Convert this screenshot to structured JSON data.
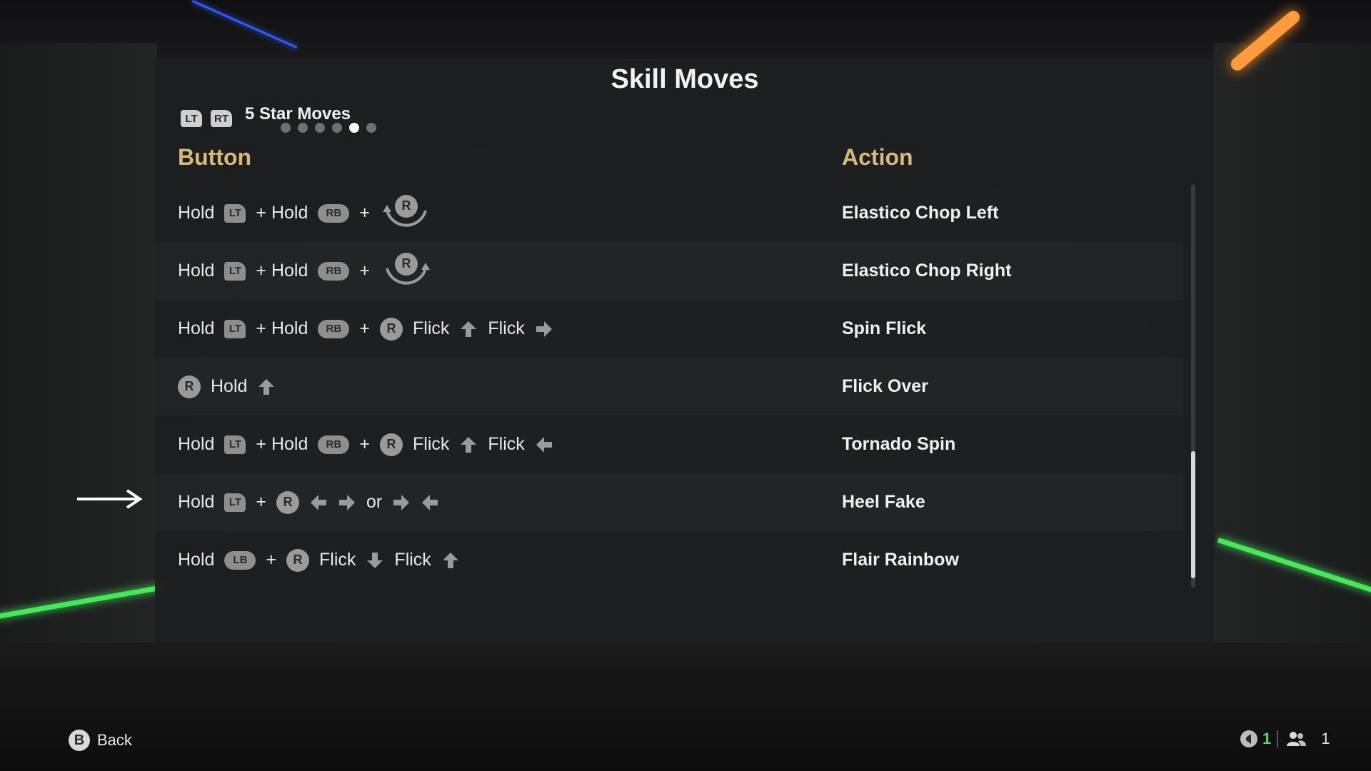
{
  "title": "Skill Moves",
  "category": {
    "triggers": [
      "LT",
      "RT"
    ],
    "label": "5 Star Moves",
    "page_count": 6,
    "active_page": 5
  },
  "columns": {
    "button": "Button",
    "action": "Action"
  },
  "moves": [
    {
      "tokens": [
        "Hold",
        "LT",
        "+ Hold",
        "RB",
        "+",
        "R-rotate-left"
      ],
      "action": "Elastico Chop Left"
    },
    {
      "tokens": [
        "Hold",
        "LT",
        "+ Hold",
        "RB",
        "+",
        "R-rotate-right"
      ],
      "action": "Elastico Chop Right"
    },
    {
      "tokens": [
        "Hold",
        "LT",
        "+ Hold",
        "RB",
        "+",
        "R",
        "Flick",
        "arrow-up",
        "Flick",
        "arrow-right"
      ],
      "action": "Spin Flick"
    },
    {
      "tokens": [
        "R",
        "Hold",
        "arrow-up"
      ],
      "action": "Flick Over"
    },
    {
      "tokens": [
        "Hold",
        "LT",
        "+ Hold",
        "RB",
        "+",
        "R",
        "Flick",
        "arrow-up",
        "Flick",
        "arrow-left"
      ],
      "action": "Tornado Spin"
    },
    {
      "tokens": [
        "Hold",
        "LT",
        "+",
        "R",
        "arrow-left",
        "arrow-right",
        "or",
        "arrow-right",
        "arrow-left"
      ],
      "action": "Heel Fake"
    },
    {
      "tokens": [
        "Hold",
        "LB",
        "+",
        "R",
        "Flick",
        "arrow-down",
        "Flick",
        "arrow-up"
      ],
      "action": "Flair Rainbow"
    }
  ],
  "footer": {
    "back_button": "B",
    "back_label": "Back",
    "player_count_1": "1",
    "player_count_2": "1"
  },
  "colors": {
    "column_header": "#d7b97c",
    "accent_green": "#5cd65c"
  },
  "scroll_position": 0.75
}
